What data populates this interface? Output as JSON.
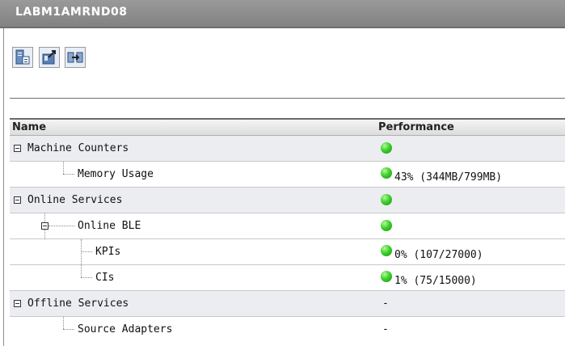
{
  "window": {
    "title": "LABM1AMRND08"
  },
  "toolbar": {
    "buttons": [
      "properties-icon",
      "export-icon",
      "refresh-icon"
    ]
  },
  "table": {
    "columns": {
      "name": "Name",
      "performance": "Performance"
    },
    "rows": [
      {
        "name": "Machine Counters",
        "status": "green",
        "value": ""
      },
      {
        "name": "Memory Usage",
        "status": "green",
        "value": "43% (344MB/799MB)"
      },
      {
        "name": "Online Services",
        "status": "green",
        "value": ""
      },
      {
        "name": "Online BLE",
        "status": "green",
        "value": ""
      },
      {
        "name": "KPIs",
        "status": "green",
        "value": "0% (107/27000)"
      },
      {
        "name": "CIs",
        "status": "green",
        "value": "1% (75/15000)"
      },
      {
        "name": "Offline Services",
        "status": "none",
        "value": "-"
      },
      {
        "name": "Source Adapters",
        "status": "none",
        "value": "-"
      }
    ]
  },
  "colors": {
    "status_ok": "#3bd12a",
    "titlebar": "#8c8c8c"
  }
}
